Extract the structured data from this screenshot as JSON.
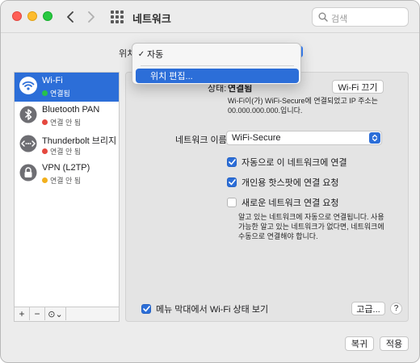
{
  "window": {
    "title": "네트워크",
    "search_placeholder": "검색"
  },
  "location": {
    "label": "위치",
    "menu": {
      "current_label": "자동",
      "current_mark": "✓",
      "edit_label": "위치 편집..."
    }
  },
  "sidebar": {
    "items": [
      {
        "name": "Wi-Fi",
        "status": "연결됨",
        "status_color": "#27c24c",
        "icon": "wifi-icon",
        "selected": true
      },
      {
        "name": "Bluetooth PAN",
        "status": "연결 안 됨",
        "status_color": "#e5483f",
        "icon": "bluetooth-icon",
        "selected": false
      },
      {
        "name": "Thunderbolt 브리지",
        "status": "연결 안 됨",
        "status_color": "#e5483f",
        "icon": "thunderbolt-bridge-icon",
        "selected": false
      },
      {
        "name": "VPN (L2TP)",
        "status": "연결 안 됨",
        "status_color": "#f2b01e",
        "icon": "lock-icon",
        "selected": false
      }
    ],
    "toolbar": {
      "add": "+",
      "remove": "−",
      "gear": "⊙⌄"
    }
  },
  "detail": {
    "status_label": "상태:",
    "status_value": "연결됨",
    "wifi_off_button": "Wi-Fi 끄기",
    "status_description": "Wi-Fi이(가) WiFi-Secure에 연결되었고 IP 주소는 00.000.000.000.입니다.",
    "network_name_label": "네트워크 이름:",
    "network_name_value": "WiFi-Secure",
    "options": [
      {
        "label": "자동으로 이 네트워크에 연결",
        "checked": true
      },
      {
        "label": "개인용 핫스팟에 연결 요청",
        "checked": true
      },
      {
        "label": "새로운 네트워크 연결 요청",
        "checked": false
      }
    ],
    "helper_text": "알고 있는 네트워크에 자동으로 연결됩니다. 사용 가능한 알고 있는 네트워크가 없다면, 네트워크에 수동으로 연결해야 합니다.",
    "menubar_status_label": "메뉴 막대에서 Wi-Fi 상태 보기",
    "menubar_status_checked": true,
    "advanced_button": "고급...",
    "help_button": "?"
  },
  "footer": {
    "revert_button": "복귀",
    "apply_button": "적용"
  },
  "colors": {
    "accent": "#2c6ed8",
    "connected": "#27c24c",
    "disconnected": "#e5483f",
    "vpn_inactive": "#f2b01e"
  }
}
